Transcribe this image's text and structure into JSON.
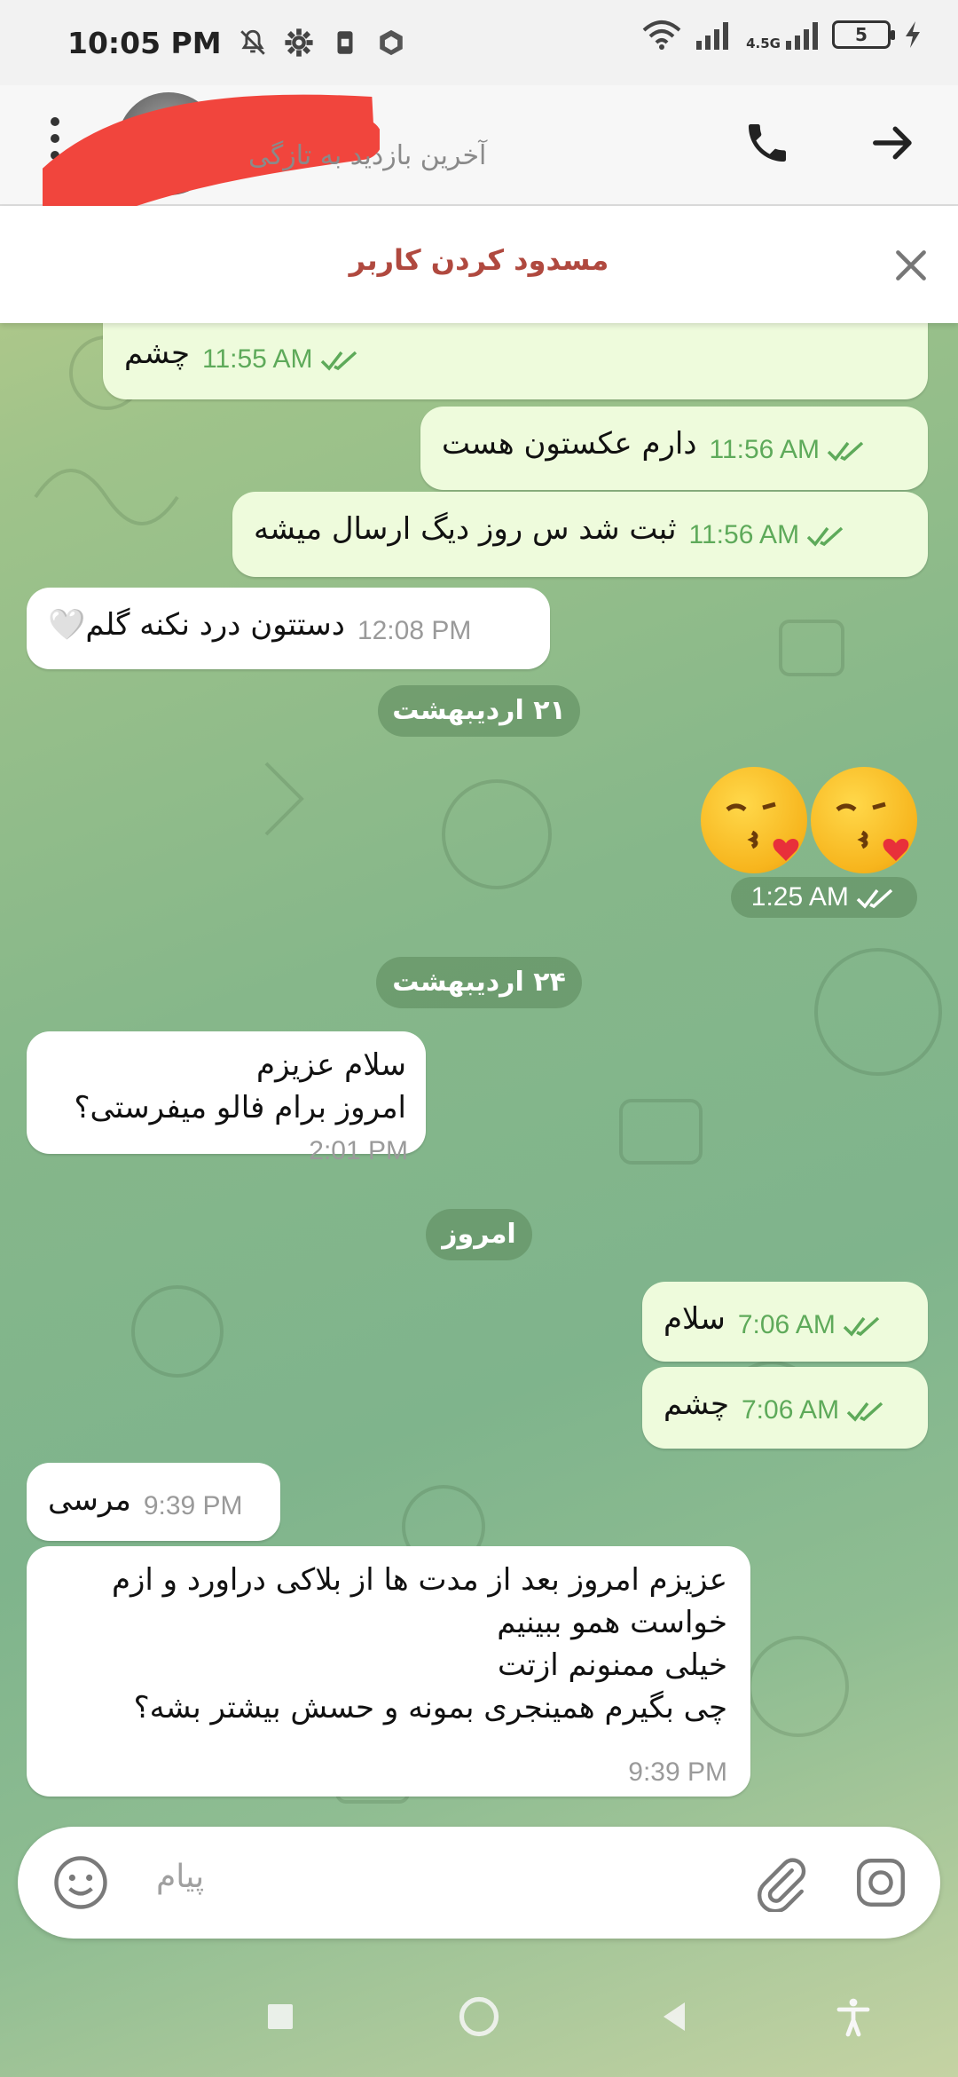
{
  "status_bar": {
    "time": "10:05 PM",
    "network_type": "4.5G",
    "battery": "5",
    "icons_left": [
      "mute-icon",
      "gear-icon",
      "sim-icon",
      "app-icon"
    ],
    "icons_right": [
      "wifi-icon",
      "signal-icon",
      "signal-icon",
      "battery-icon",
      "charging-icon"
    ]
  },
  "header": {
    "last_seen": "آخرین بازدید به تازگی",
    "actions": [
      "phone-icon",
      "forward-arrow-icon"
    ]
  },
  "block_banner": {
    "label": "مسدود کردن کاربر",
    "close_icon": "close-icon"
  },
  "messages": [
    {
      "dir": "out",
      "text": "چشم",
      "time": "11:55 AM"
    },
    {
      "dir": "out",
      "text": "دارم عکستون هست",
      "time": "11:56 AM"
    },
    {
      "dir": "out",
      "text": "ثبت شد س روز دیگ ارسال میشه",
      "time": "11:56 AM"
    },
    {
      "dir": "in",
      "text": "دستتون درد نکنه گلم🤍",
      "time": "12:08 PM"
    },
    {
      "dir": "date",
      "text": "۲۱ اردیبهشت"
    },
    {
      "dir": "out",
      "text": "😘😘",
      "time": "1:25 AM"
    },
    {
      "dir": "date",
      "text": "۲۴ اردیبهشت"
    },
    {
      "dir": "in",
      "lines": [
        "سلام عزیزم",
        "امروز برام فالو میفرستی؟"
      ],
      "time": "2:01 PM"
    },
    {
      "dir": "date",
      "text": "امروز"
    },
    {
      "dir": "out",
      "text": "سلام",
      "time": "7:06 AM"
    },
    {
      "dir": "out",
      "text": "چشم",
      "time": "7:06 AM"
    },
    {
      "dir": "in",
      "text": "مرسی",
      "time": "9:39 PM"
    },
    {
      "dir": "in",
      "lines": [
        "عزیزم امروز بعد از مدت ها از بلاکی دراورد و ازم",
        "خواست همو ببینیم",
        "خیلی ممنونم ازتت",
        "چی بگیرم همینجری بمونه و حسش بیشتر بشه؟"
      ],
      "time": "9:39 PM"
    }
  ],
  "input": {
    "placeholder": "پیام",
    "icons": [
      "emoji-icon",
      "attach-icon",
      "camera-icon"
    ]
  },
  "nav": [
    "square-icon",
    "circle-icon",
    "back-icon",
    "accessibility-icon"
  ],
  "colors": {
    "outgoing_bubble": "#eefbdc",
    "incoming_bubble": "#ffffff",
    "time_out": "#5eaa5a",
    "block_label": "#b0493f",
    "date_pill": "#608c60"
  }
}
